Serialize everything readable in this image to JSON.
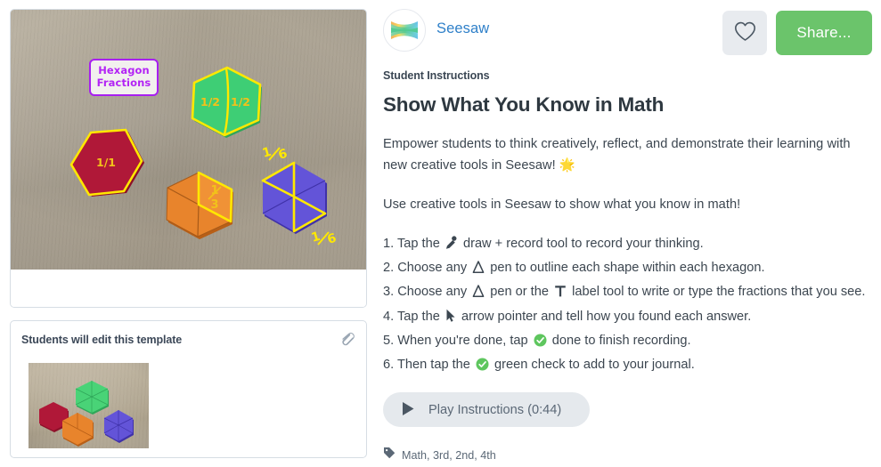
{
  "left": {
    "photo": {
      "alt_label": "hexagon-pattern-blocks-photo",
      "annotation_label_line1": "Hexagon",
      "annotation_label_line2": "Fractions",
      "shapes": [
        {
          "name": "red-hexagon",
          "color": "#b01838",
          "fraction": "1/1",
          "divisions": 1
        },
        {
          "name": "green-hexagon",
          "color": "#3ece75",
          "fraction_left": "1/2",
          "fraction_right": "1/2",
          "divisions": 2
        },
        {
          "name": "orange-hexagon",
          "color": "#e8842c",
          "fraction": "1/3",
          "divisions": 3
        },
        {
          "name": "blue-hexagon",
          "color": "#6354d8",
          "fraction_top": "1/6",
          "fraction_bottom": "1/6",
          "divisions": 6
        }
      ],
      "outline_color": "#ffe800",
      "label_border_color": "#a81ff0"
    },
    "template_card": {
      "title": "Students will edit this template",
      "attach_icon": "paperclip-icon",
      "thumbnail_alt": "hexagon-pattern-blocks-thumbnail"
    }
  },
  "right": {
    "author": {
      "name": "Seesaw",
      "avatar_icon": "seesaw-bowtie-logo"
    },
    "actions": {
      "favorite_icon": "heart-icon",
      "share_label": "Share..."
    },
    "sub_label": "Student Instructions",
    "title": "Show What You Know in Math",
    "paragraphs": [
      "Empower students to think creatively, reflect, and demonstrate their learning with new creative tools in Seesaw! 🌟",
      "Use creative tools in Seesaw to show what you know in math!"
    ],
    "steps": [
      {
        "num": "1.",
        "before": "Tap the",
        "icon": "microphone-icon",
        "after": "draw + record tool to record your thinking."
      },
      {
        "num": "2.",
        "before": "Choose any",
        "icon": "pen-triangle-icon",
        "after": "pen to outline each shape within each hexagon."
      },
      {
        "num": "3.",
        "before": "Choose any",
        "icon": "pen-triangle-icon",
        "middle": "pen or the",
        "icon2": "text-label-icon",
        "after": "label tool to write or type the fractions that you see."
      },
      {
        "num": "4.",
        "before": "Tap the",
        "icon": "arrow-pointer-icon",
        "after": "arrow pointer and tell how you found each answer."
      },
      {
        "num": "5.",
        "before": "When you're done, tap",
        "icon": "green-check-icon",
        "after": "done to finish recording."
      },
      {
        "num": "6.",
        "before": "Then tap the",
        "icon": "green-check-icon",
        "after": "green check to add to your journal."
      }
    ],
    "play_button": {
      "icon": "play-icon",
      "label": "Play Instructions (0:44)"
    },
    "tags": {
      "icon": "tag-icon",
      "text": "Math, 3rd, 2nd, 4th"
    }
  },
  "colors": {
    "share_green": "#6bc46b",
    "link_blue": "#2f80c9",
    "check_green": "#5ec65e",
    "card_border": "#d6dde4",
    "text_dark": "#3c4650"
  }
}
